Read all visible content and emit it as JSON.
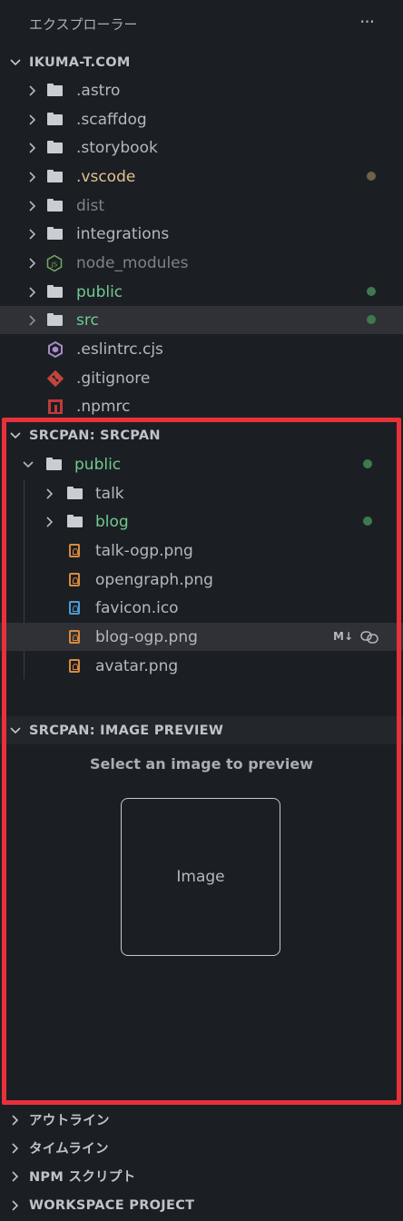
{
  "explorer": {
    "title": "エクスプローラー",
    "more_label": "···",
    "root_label": "IKUMA-T.COM",
    "items": [
      {
        "label": ".astro",
        "color": "#b4b9bf"
      },
      {
        "label": ".scaffdog",
        "color": "#b4b9bf"
      },
      {
        "label": ".storybook",
        "color": "#b4b9bf"
      },
      {
        "label": ".vscode",
        "color": "#e2c08d",
        "dot": "#6e6346"
      },
      {
        "label": "dist",
        "color": "#7d838a"
      },
      {
        "label": "integrations",
        "color": "#b4b9bf"
      },
      {
        "label": "node_modules",
        "color": "#7d838a"
      },
      {
        "label": "public",
        "color": "#73c991",
        "dot": "#3e7a4e"
      },
      {
        "label": "src",
        "color": "#73c991",
        "dot": "#3e7a4e"
      },
      {
        "label": ".eslintrc.cjs",
        "color": "#b4b9bf"
      },
      {
        "label": ".gitignore",
        "color": "#b4b9bf"
      },
      {
        "label": ".npmrc",
        "color": "#b4b9bf"
      }
    ]
  },
  "srcpan": {
    "header": "SRCPAN: SRCPAN",
    "root": {
      "label": "public",
      "color": "#73c991"
    },
    "items": [
      {
        "label": "talk",
        "color": "#b4b9bf"
      },
      {
        "label": "blog",
        "color": "#73c991"
      },
      {
        "label": "talk-ogp.png",
        "color": "#b4b9bf"
      },
      {
        "label": "opengraph.png",
        "color": "#b4b9bf"
      },
      {
        "label": "favicon.ico",
        "color": "#b4b9bf"
      },
      {
        "label": "blog-ogp.png",
        "color": "#b4b9bf"
      },
      {
        "label": "avatar.png",
        "color": "#b4b9bf"
      }
    ],
    "markdown_badge": "M↓"
  },
  "image_preview": {
    "header": "SRCPAN: IMAGE PREVIEW",
    "prompt": "Select an image to preview",
    "placeholder": "Image"
  },
  "bottom_sections": [
    {
      "label": "アウトライン"
    },
    {
      "label": "タイムライン"
    },
    {
      "label": "NPM スクリプト"
    },
    {
      "label": "WORKSPACE PROJECT"
    }
  ],
  "colors": {
    "highlight_border": "#e8313a",
    "background": "#1b1f23",
    "selection": "#2f3136"
  }
}
